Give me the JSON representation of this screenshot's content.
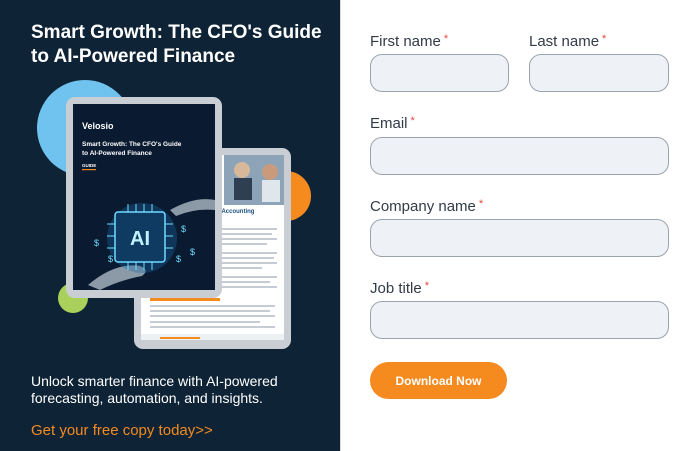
{
  "promo": {
    "title": "Smart Growth: The CFO's Guide to AI-Powered Finance",
    "description": "Unlock smarter finance with AI-powered forecasting, automation, and insights.",
    "cta_link": "Get your free copy today>>",
    "book": {
      "brand": "Velosio",
      "cover_title": "Smart Growth: The CFO's Guide to AI-Powered Finance",
      "cover_tag": "GUIDE",
      "ai_badge": "AI",
      "page_heading": "ed Accounting"
    }
  },
  "form": {
    "first_name_label": "First name",
    "last_name_label": "Last name",
    "email_label": "Email",
    "company_label": "Company name",
    "job_title_label": "Job title",
    "required_marker": "*",
    "first_name_value": "",
    "last_name_value": "",
    "email_value": "",
    "company_value": "",
    "job_title_value": "",
    "submit_label": "Download Now"
  },
  "colors": {
    "panel_bg": "#0e2436",
    "accent_orange": "#f58a1f",
    "accent_blue": "#6fc3ee",
    "accent_green": "#a9d05a",
    "input_bg": "#eef2f6"
  }
}
